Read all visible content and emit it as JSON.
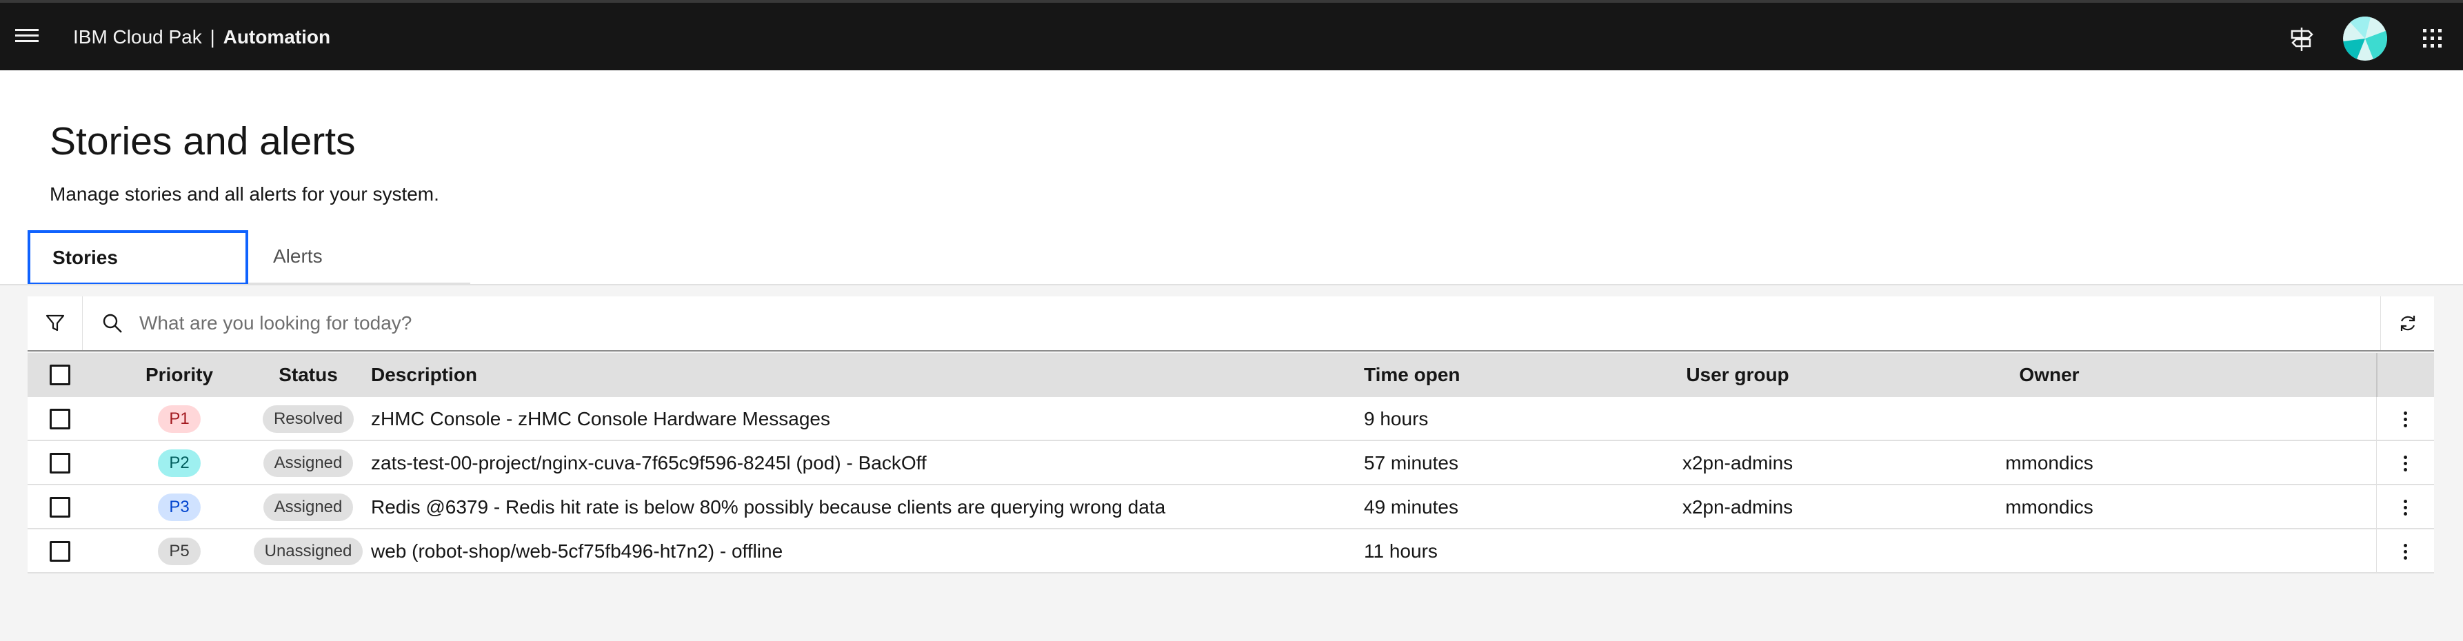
{
  "header": {
    "brand_prefix": "IBM Cloud Pak",
    "brand_separator": "|",
    "brand_product": "Automation",
    "icons": [
      "menu-icon",
      "signpost-icon",
      "avatar",
      "app-switcher-icon"
    ]
  },
  "page": {
    "title": "Stories and alerts",
    "subtitle": "Manage stories and all alerts for your system."
  },
  "tabs": [
    {
      "label": "Stories",
      "selected": true
    },
    {
      "label": "Alerts",
      "selected": false
    }
  ],
  "toolbar": {
    "search_placeholder": "What are you looking for today?",
    "icons": [
      "filter-icon",
      "search-icon",
      "refresh-icon"
    ]
  },
  "table": {
    "columns": [
      "Priority",
      "Status",
      "Description",
      "Time open",
      "User group",
      "Owner"
    ],
    "rows": [
      {
        "priority": "P1",
        "status": "Resolved",
        "description": "zHMC Console - zHMC Console Hardware Messages",
        "time_open": "9 hours",
        "user_group": "",
        "owner": ""
      },
      {
        "priority": "P2",
        "status": "Assigned",
        "description": "zats-test-00-project/nginx-cuva-7f65c9f596-8245l (pod) - BackOff",
        "time_open": "57 minutes",
        "user_group": "x2pn-admins",
        "owner": "mmondics"
      },
      {
        "priority": "P3",
        "status": "Assigned",
        "description": "Redis @6379 - Redis hit rate is below 80% possibly because clients are querying wrong data",
        "time_open": "49 minutes",
        "user_group": "x2pn-admins",
        "owner": "mmondics"
      },
      {
        "priority": "P5",
        "status": "Unassigned",
        "description": "web (robot-shop/web-5cf75fb496-ht7n2) - offline",
        "time_open": "11 hours",
        "user_group": "",
        "owner": ""
      }
    ]
  },
  "colors": {
    "header_bg": "#161616",
    "accent": "#0f62fe",
    "p1_bg": "#ffd7d9",
    "p2_bg": "#9ef0f0",
    "p3_bg": "#d0e2ff",
    "p5_bg": "#e0e0e0"
  }
}
